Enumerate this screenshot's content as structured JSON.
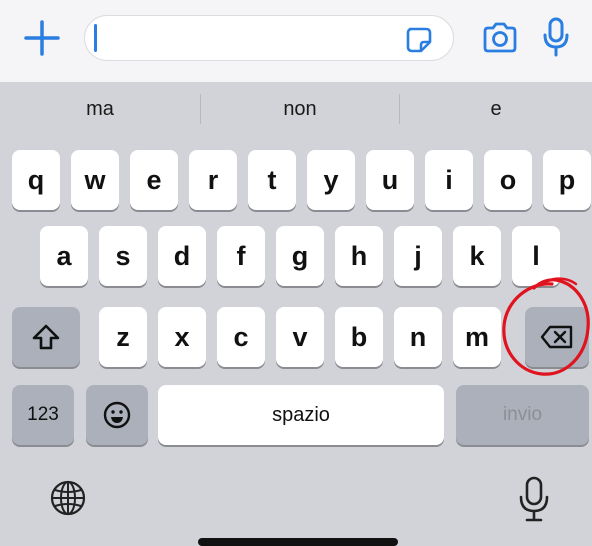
{
  "input_bar": {
    "icons": [
      "plus-icon",
      "sticker-icon",
      "camera-icon",
      "microphone-icon"
    ],
    "accent_color": "#2a7de1"
  },
  "suggestions": [
    "ma",
    "non",
    "e"
  ],
  "keyboard": {
    "row1": [
      "q",
      "w",
      "e",
      "r",
      "t",
      "y",
      "u",
      "i",
      "o",
      "p"
    ],
    "row2": [
      "a",
      "s",
      "d",
      "f",
      "g",
      "h",
      "j",
      "k",
      "l"
    ],
    "row3": [
      "z",
      "x",
      "c",
      "v",
      "b",
      "n",
      "m"
    ],
    "numbers_label": "123",
    "space_label": "spazio",
    "enter_label": "invio",
    "function_icons": [
      "shift-icon",
      "delete-icon",
      "emoji-icon",
      "globe-icon",
      "microphone-icon"
    ]
  },
  "annotation": {
    "shape": "hand-drawn-circle",
    "color": "#e0141e",
    "target": "delete-key"
  }
}
